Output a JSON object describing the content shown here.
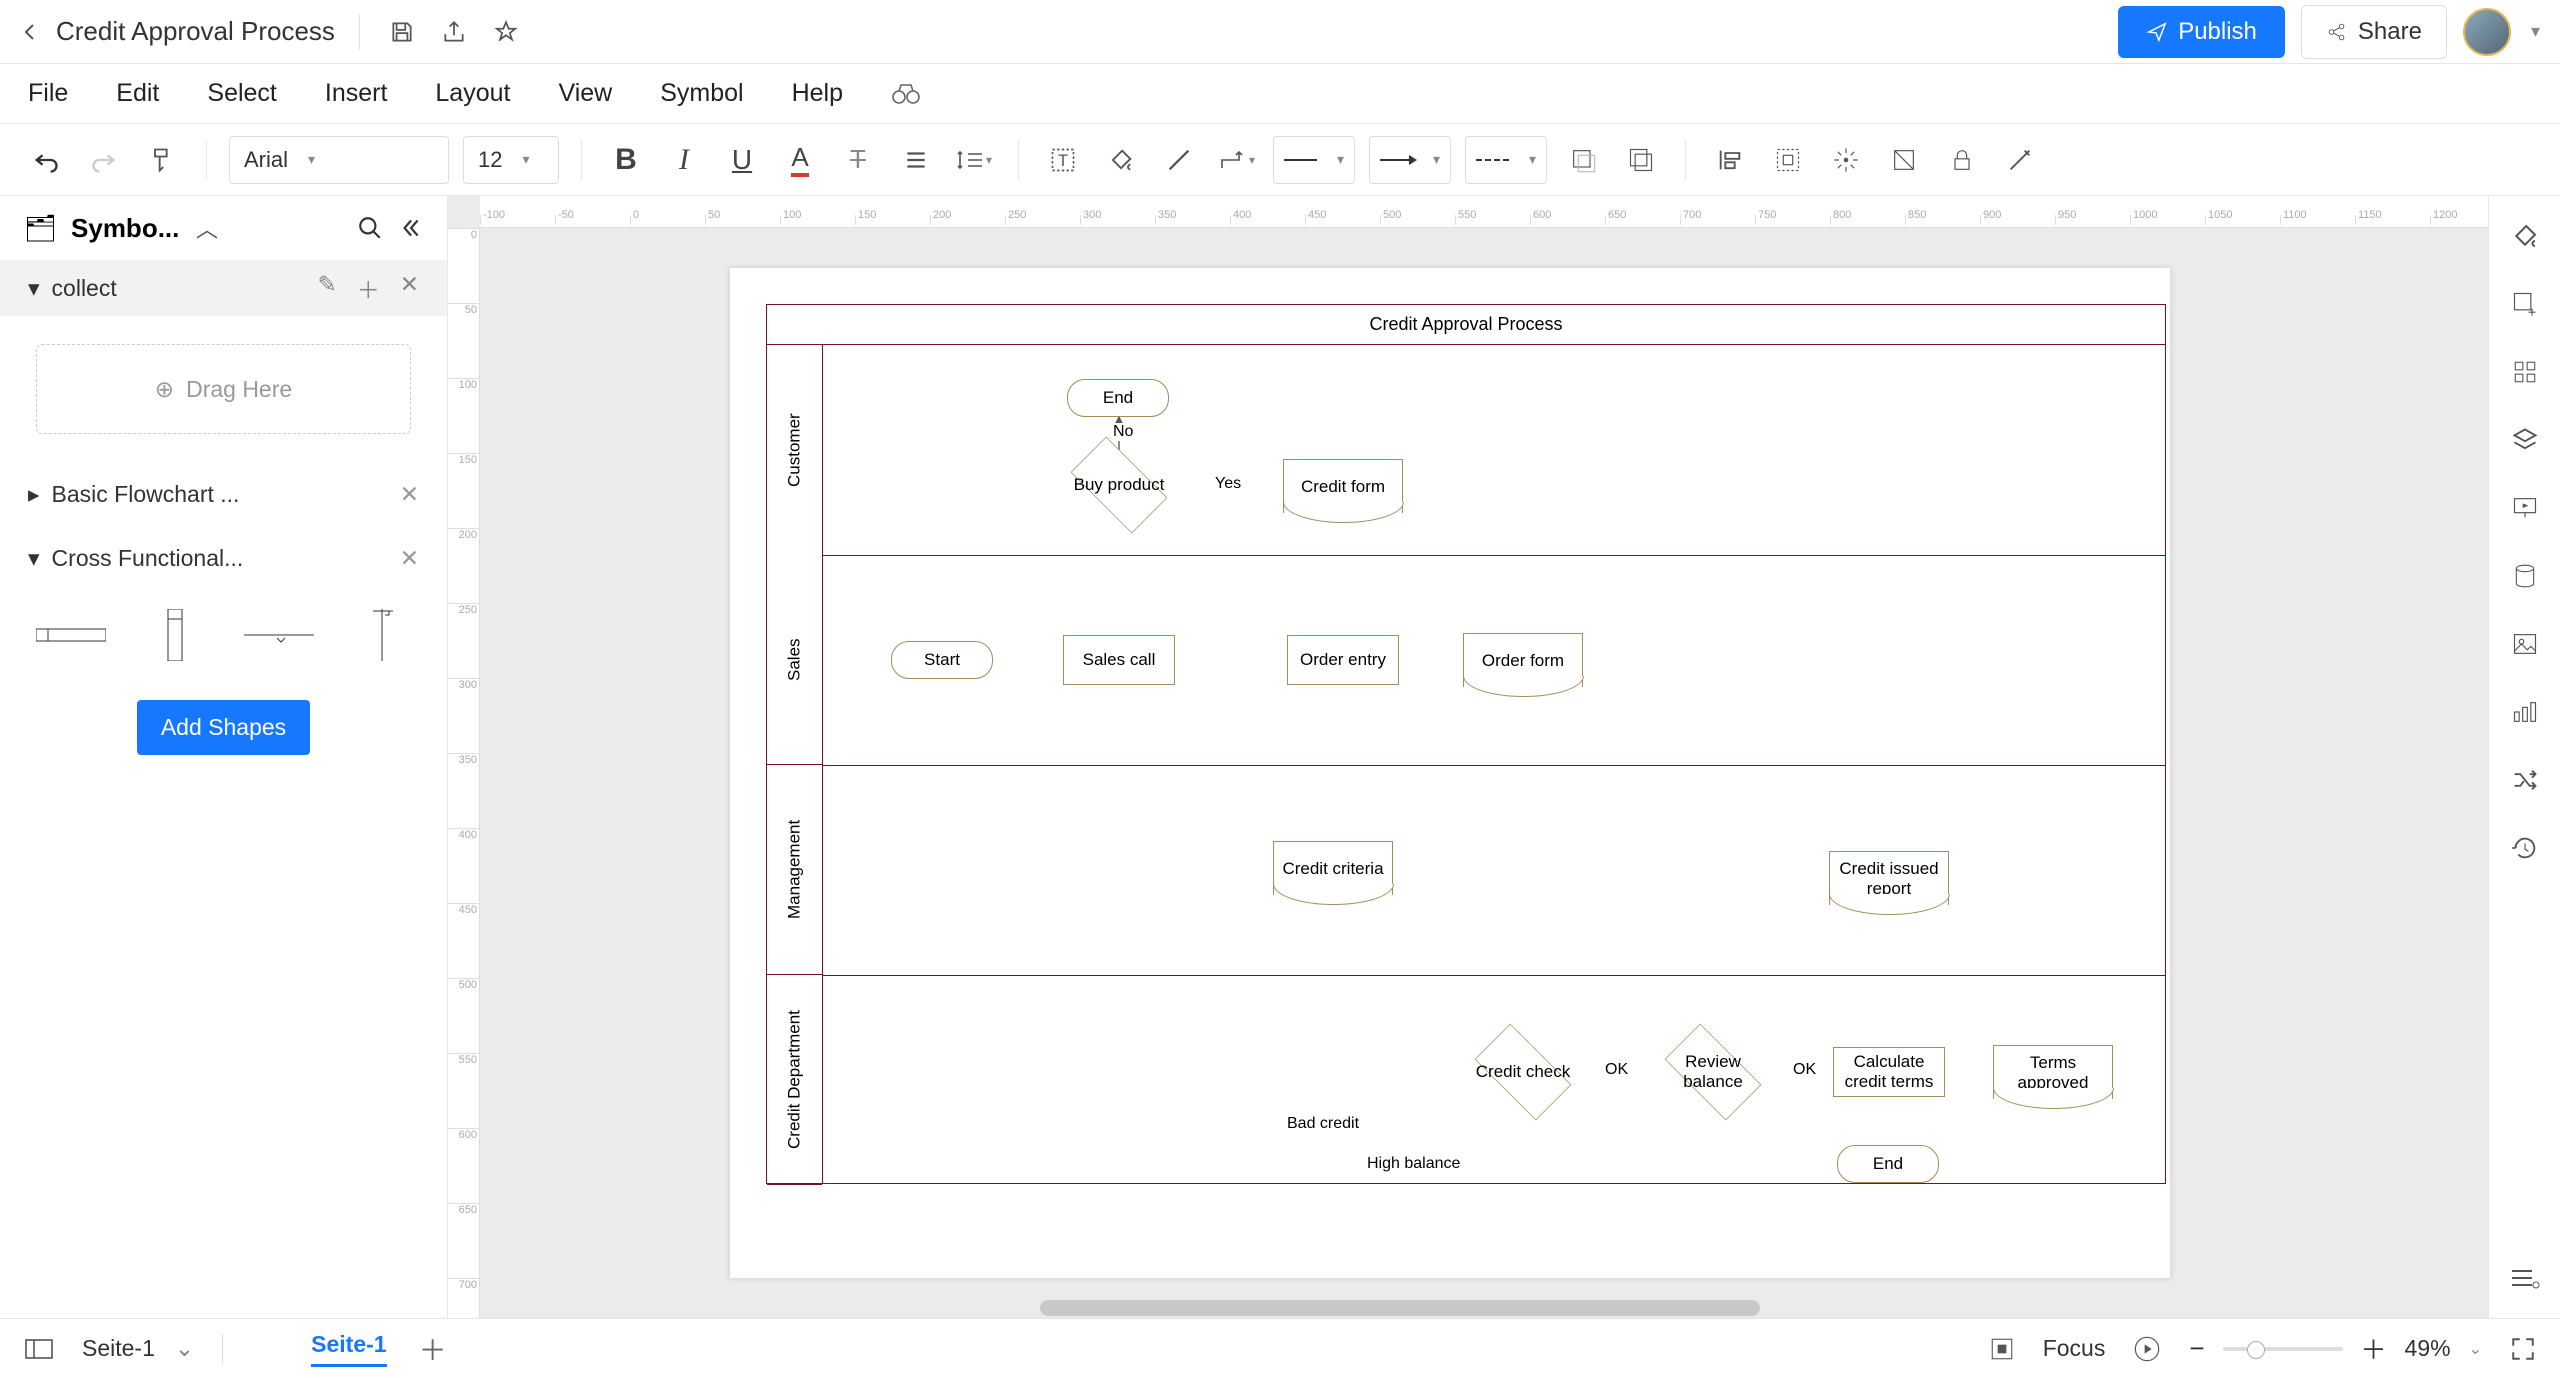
{
  "title_bar": {
    "document_title": "Credit Approval Process"
  },
  "menus": {
    "file": "File",
    "edit": "Edit",
    "select": "Select",
    "insert": "Insert",
    "layout": "Layout",
    "view": "View",
    "symbol": "Symbol",
    "help": "Help"
  },
  "buttons": {
    "publish": "Publish",
    "share": "Share",
    "add_shapes": "Add Shapes"
  },
  "toolbar": {
    "font": "Arial",
    "font_size": "12"
  },
  "left_panel": {
    "title": "Symbo...",
    "collect_label": "collect",
    "drag_here": "Drag Here",
    "basic_flowchart": "Basic Flowchart ...",
    "cross_functional": "Cross Functional..."
  },
  "diagram": {
    "title": "Credit Approval Process",
    "lanes": [
      "Customer",
      "Sales",
      "Management",
      "Credit Department"
    ],
    "nodes": {
      "end_customer": "End",
      "no": "No",
      "buy_product": "Buy product",
      "yes": "Yes",
      "credit_form": "Credit form",
      "start": "Start",
      "sales_call": "Sales call",
      "order_entry": "Order entry",
      "order_form": "Order form",
      "credit_criteria": "Credit criteria",
      "credit_check": "Credit check",
      "bad_credit": "Bad credit",
      "ok1": "OK",
      "review_balance": "Review balance",
      "high_balance": "High balance",
      "ok2": "OK",
      "calculate_terms": "Calculate credit terms",
      "credit_issued": "Credit issued report",
      "terms_approved": "Terms approved",
      "end_credit": "End"
    }
  },
  "status_bar": {
    "page_selector": "Seite-1",
    "active_tab": "Seite-1",
    "focus": "Focus",
    "zoom": "49%"
  },
  "chart_data": {
    "type": "swimlane-flowchart",
    "title": "Credit Approval Process",
    "lanes": [
      "Customer",
      "Sales",
      "Management",
      "Credit Department"
    ],
    "nodes": [
      {
        "id": "start",
        "lane": "Sales",
        "type": "terminator",
        "label": "Start"
      },
      {
        "id": "sales_call",
        "lane": "Sales",
        "type": "process",
        "label": "Sales call"
      },
      {
        "id": "buy_product",
        "lane": "Customer",
        "type": "decision",
        "label": "Buy product"
      },
      {
        "id": "end_customer",
        "lane": "Customer",
        "type": "terminator",
        "label": "End"
      },
      {
        "id": "credit_form",
        "lane": "Customer",
        "type": "document",
        "label": "Credit form"
      },
      {
        "id": "order_entry",
        "lane": "Sales",
        "type": "process",
        "label": "Order entry"
      },
      {
        "id": "order_form",
        "lane": "Sales",
        "type": "document",
        "label": "Order form"
      },
      {
        "id": "credit_criteria",
        "lane": "Management",
        "type": "document",
        "label": "Credit criteria"
      },
      {
        "id": "credit_check",
        "lane": "Credit Department",
        "type": "decision",
        "label": "Credit check"
      },
      {
        "id": "review_balance",
        "lane": "Credit Department",
        "type": "decision",
        "label": "Review balance"
      },
      {
        "id": "calculate_terms",
        "lane": "Credit Department",
        "type": "process",
        "label": "Calculate credit terms"
      },
      {
        "id": "credit_issued",
        "lane": "Management",
        "type": "document",
        "label": "Credit issued report"
      },
      {
        "id": "terms_approved",
        "lane": "Credit Department",
        "type": "document",
        "label": "Terms approved"
      },
      {
        "id": "end_credit",
        "lane": "Credit Department",
        "type": "terminator",
        "label": "End"
      }
    ],
    "edges": [
      {
        "from": "start",
        "to": "sales_call"
      },
      {
        "from": "sales_call",
        "to": "buy_product"
      },
      {
        "from": "buy_product",
        "to": "end_customer",
        "label": "No"
      },
      {
        "from": "buy_product",
        "to": "credit_form",
        "label": "Yes"
      },
      {
        "from": "credit_form",
        "to": "order_entry"
      },
      {
        "from": "order_entry",
        "to": "order_form"
      },
      {
        "from": "order_form",
        "to": "credit_check"
      },
      {
        "from": "credit_criteria",
        "to": "credit_check"
      },
      {
        "from": "credit_check",
        "to": "sales_call",
        "label": "Bad credit"
      },
      {
        "from": "credit_check",
        "to": "review_balance",
        "label": "OK"
      },
      {
        "from": "review_balance",
        "to": "sales_call",
        "label": "High balance"
      },
      {
        "from": "review_balance",
        "to": "calculate_terms",
        "label": "OK"
      },
      {
        "from": "calculate_terms",
        "to": "credit_issued"
      },
      {
        "from": "calculate_terms",
        "to": "terms_approved"
      },
      {
        "from": "calculate_terms",
        "to": "end_credit"
      }
    ]
  }
}
